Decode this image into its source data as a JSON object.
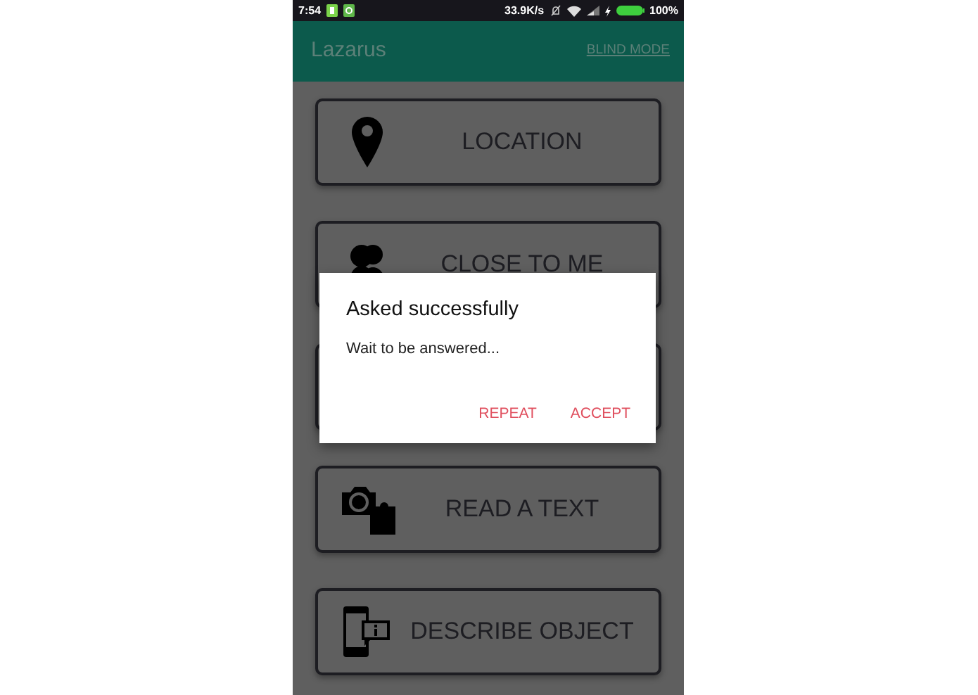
{
  "status_bar": {
    "time": "7:54",
    "speed": "33.9K/s",
    "battery": "100%"
  },
  "app_bar": {
    "title": "Lazarus",
    "action": "BLIND MODE"
  },
  "buttons": [
    {
      "kind": "pin",
      "label": "LOCATION"
    },
    {
      "kind": "people",
      "label": "CLOSE TO ME"
    },
    {
      "kind": "hidden"
    },
    {
      "kind": "camera",
      "label": "READ A TEXT"
    },
    {
      "kind": "phone",
      "label": "DESCRIBE OBJECT"
    }
  ],
  "dialog": {
    "title": "Asked successfully",
    "message": "Wait to be answered...",
    "actions": [
      "REPEAT",
      "ACCEPT"
    ]
  }
}
